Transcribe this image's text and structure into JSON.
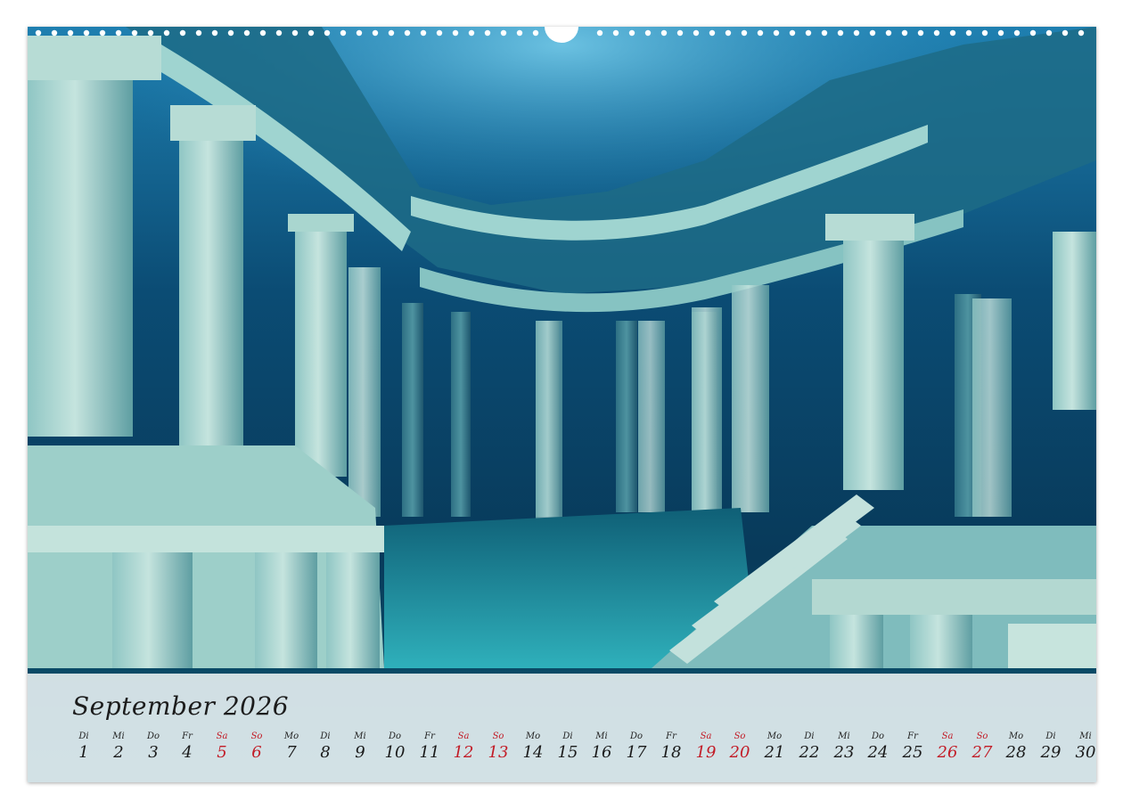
{
  "calendar": {
    "month_title": "September 2026",
    "weekend_color": "#c21b26",
    "days": [
      {
        "wd": "Di",
        "d": "1"
      },
      {
        "wd": "Mi",
        "d": "2"
      },
      {
        "wd": "Do",
        "d": "3"
      },
      {
        "wd": "Fr",
        "d": "4"
      },
      {
        "wd": "Sa",
        "d": "5",
        "we": true
      },
      {
        "wd": "So",
        "d": "6",
        "we": true
      },
      {
        "wd": "Mo",
        "d": "7"
      },
      {
        "wd": "Di",
        "d": "8"
      },
      {
        "wd": "Mi",
        "d": "9"
      },
      {
        "wd": "Do",
        "d": "10"
      },
      {
        "wd": "Fr",
        "d": "11"
      },
      {
        "wd": "Sa",
        "d": "12",
        "we": true
      },
      {
        "wd": "So",
        "d": "13",
        "we": true
      },
      {
        "wd": "Mo",
        "d": "14"
      },
      {
        "wd": "Di",
        "d": "15"
      },
      {
        "wd": "Mi",
        "d": "16"
      },
      {
        "wd": "Do",
        "d": "17"
      },
      {
        "wd": "Fr",
        "d": "18"
      },
      {
        "wd": "Sa",
        "d": "19",
        "we": true
      },
      {
        "wd": "So",
        "d": "20",
        "we": true
      },
      {
        "wd": "Mo",
        "d": "21"
      },
      {
        "wd": "Di",
        "d": "22"
      },
      {
        "wd": "Mi",
        "d": "23"
      },
      {
        "wd": "Do",
        "d": "24"
      },
      {
        "wd": "Fr",
        "d": "25"
      },
      {
        "wd": "Sa",
        "d": "26",
        "we": true
      },
      {
        "wd": "So",
        "d": "27",
        "we": true
      },
      {
        "wd": "Mo",
        "d": "28"
      },
      {
        "wd": "Di",
        "d": "29"
      },
      {
        "wd": "Mi",
        "d": "30"
      }
    ]
  }
}
